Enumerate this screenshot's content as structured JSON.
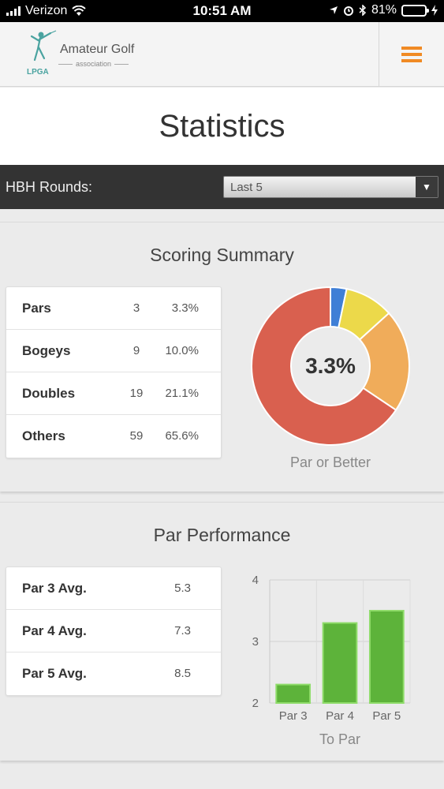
{
  "status_bar": {
    "carrier": "Verizon",
    "time": "10:51 AM",
    "battery": "81%",
    "battery_level": 0.81
  },
  "header": {
    "logo_name": "Amateur Golf",
    "logo_sub": "association",
    "logo_mark": "LPGA",
    "menu_icon": "hamburger-menu-icon"
  },
  "page": {
    "title": "Statistics"
  },
  "rounds": {
    "label": "HBH Rounds:",
    "selected": "Last 5"
  },
  "scoring_summary": {
    "title": "Scoring Summary",
    "rows": [
      {
        "label": "Pars",
        "count": "3",
        "pct": "3.3%"
      },
      {
        "label": "Bogeys",
        "count": "9",
        "pct": "10.0%"
      },
      {
        "label": "Doubles",
        "count": "19",
        "pct": "21.1%"
      },
      {
        "label": "Others",
        "count": "59",
        "pct": "65.6%"
      }
    ],
    "center_value": "3.3%",
    "caption": "Par or Better"
  },
  "par_performance": {
    "title": "Par Performance",
    "rows": [
      {
        "label": "Par 3 Avg.",
        "value": "5.3"
      },
      {
        "label": "Par 4 Avg.",
        "value": "7.3"
      },
      {
        "label": "Par 5 Avg.",
        "value": "8.5"
      }
    ]
  },
  "chart_data": [
    {
      "type": "pie",
      "categories": [
        "Par or Better",
        "Bogeys",
        "Doubles",
        "Others"
      ],
      "values": [
        3.3,
        10.0,
        21.1,
        65.6
      ],
      "colors": [
        "#3f7fd6",
        "#ecd94a",
        "#f0ac5a",
        "#d9604f"
      ],
      "center_label": "3.3%",
      "xlabel": "Par or Better"
    },
    {
      "type": "bar",
      "categories": [
        "Par 3",
        "Par 4",
        "Par 5"
      ],
      "values": [
        2.3,
        3.3,
        3.5
      ],
      "xlabel": "To Par",
      "ylim": [
        2,
        4
      ],
      "yticks": [
        "2",
        "3",
        "4"
      ],
      "grid": true,
      "color": "#5db33a",
      "edge_color": "#8fdc6a"
    }
  ]
}
